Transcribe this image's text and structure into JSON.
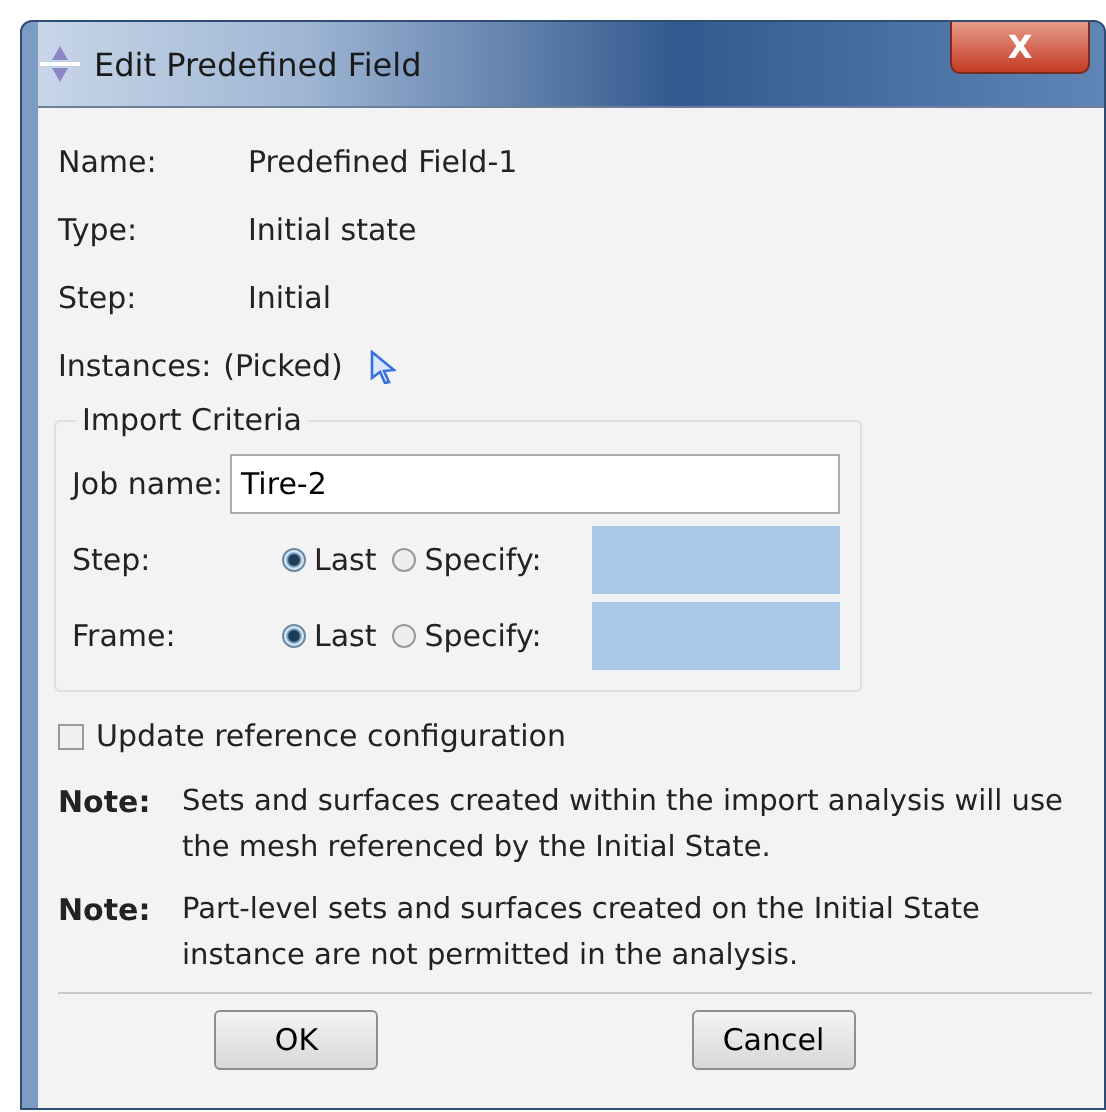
{
  "window": {
    "title": "Edit Predefined Field",
    "close": "X"
  },
  "fields": [
    {
      "label": "Name:",
      "value": "Predefined Field-1"
    },
    {
      "label": "Type:",
      "value": "Initial state"
    },
    {
      "label": "Step:",
      "value": "Initial"
    }
  ],
  "instances": {
    "label": "Instances:",
    "value": "(Picked)"
  },
  "import_criteria": {
    "title": "Import Criteria",
    "job_name": {
      "label": "Job name:",
      "value": "Tire-2"
    },
    "rows": [
      {
        "label": "Step:",
        "options": [
          {
            "label": "Last",
            "selected": true
          },
          {
            "label": "Specify:",
            "selected": false
          }
        ]
      },
      {
        "label": "Frame:",
        "options": [
          {
            "label": "Last",
            "selected": true
          },
          {
            "label": "Specify:",
            "selected": false
          }
        ]
      }
    ]
  },
  "update_reference": {
    "label": "Update reference configuration",
    "checked": false
  },
  "notes": [
    {
      "label": "Note:",
      "text": "Sets and surfaces created within the import analysis will use the mesh referenced by the Initial State."
    },
    {
      "label": "Note:",
      "text": "Part-level sets and surfaces created on the Initial State instance are not permitted in the analysis."
    }
  ],
  "buttons": [
    "OK",
    "Cancel"
  ]
}
